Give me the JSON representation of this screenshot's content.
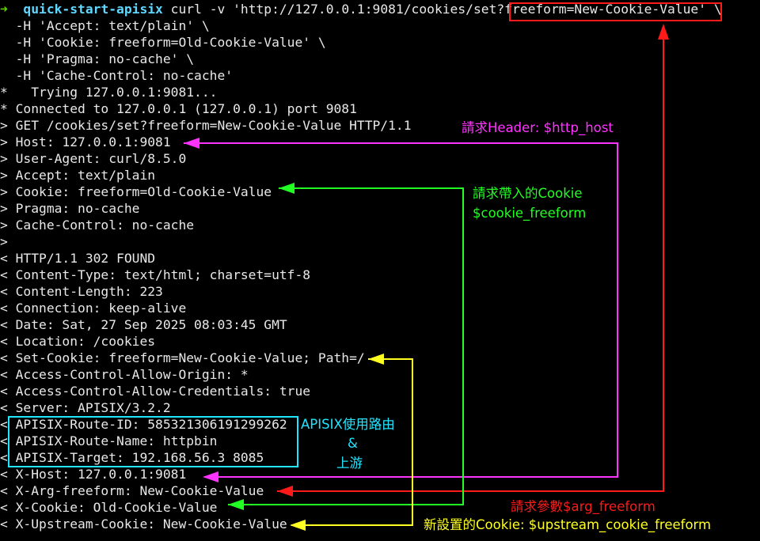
{
  "terminal": {
    "prompt": {
      "arrow": "➜",
      "directory": "quick-start-apisix",
      "command": " curl -v 'http://127.0.0.1:9081/cookies/set?freeform=New-Cookie-Value' \\"
    },
    "lines": [
      "  -H 'Accept: text/plain' \\",
      "  -H 'Cookie: freeform=Old-Cookie-Value' \\",
      "  -H 'Pragma: no-cache' \\",
      "  -H 'Cache-Control: no-cache'",
      "*   Trying 127.0.0.1:9081...",
      "* Connected to 127.0.0.1 (127.0.0.1) port 9081",
      "> GET /cookies/set?freeform=New-Cookie-Value HTTP/1.1",
      "> Host: 127.0.0.1:9081",
      "> User-Agent: curl/8.5.0",
      "> Accept: text/plain",
      "> Cookie: freeform=Old-Cookie-Value",
      "> Pragma: no-cache",
      "> Cache-Control: no-cache",
      ">",
      "< HTTP/1.1 302 FOUND",
      "< Content-Type: text/html; charset=utf-8",
      "< Content-Length: 223",
      "< Connection: keep-alive",
      "< Date: Sat, 27 Sep 2025 08:03:45 GMT",
      "< Location: /cookies",
      "< Set-Cookie: freeform=New-Cookie-Value; Path=/",
      "< Access-Control-Allow-Origin: *",
      "< Access-Control-Allow-Credentials: true",
      "< Server: APISIX/3.2.2",
      "< APISIX-Route-ID: 585321306191299262",
      "< APISIX-Route-Name: httpbin",
      "< APISIX-Target: 192.168.56.3 8085",
      "< X-Host: 127.0.0.1:9081",
      "< X-Arg-freeform: New-Cookie-Value",
      "< X-Cookie: Old-Cookie-Value",
      "< X-Upstream-Cookie: New-Cookie-Value"
    ]
  },
  "annotations": {
    "http_host": "請求Header: $http_host",
    "cookie_freeform_line1": "請求帶入的Cookie",
    "cookie_freeform_line2": "$cookie_freeform",
    "route_line1": "APISIX使用路由",
    "route_line2": "&",
    "route_line3": "上游",
    "arg_freeform": "請求參數$arg_freeform",
    "upstream_cookie": "新設置的Cookie: $upstream_cookie_freeform"
  },
  "colors": {
    "background": "#000000",
    "text": "#e8e8e8",
    "prompt_arrow": "#5fd700",
    "prompt_directory": "#5fd7ff",
    "red": "#ff1a1a",
    "magenta": "#ff33ff",
    "green": "#22ff22",
    "yellow": "#ffff22",
    "cyan": "#22e5ff"
  },
  "icons": {
    "arrow": "arrowhead-triangle"
  }
}
